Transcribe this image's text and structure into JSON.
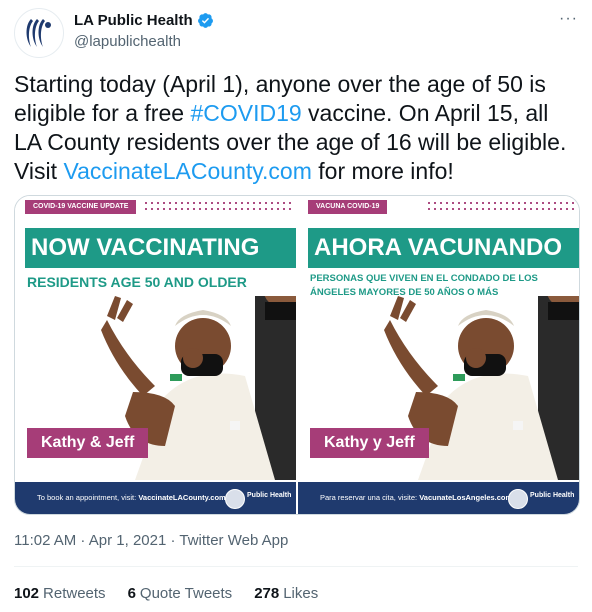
{
  "header": {
    "name": "LA Public Health",
    "handle": "@lapublichealth",
    "more_label": "···"
  },
  "tweet": {
    "text_1": "Starting today (April 1), anyone over the age of 50 is eligible for a free ",
    "hashtag": "#COVID19",
    "text_2": " vaccine. On April 15, all LA County residents over the age of 16 will be eligible. Visit ",
    "link": "VaccinateLACounty.com",
    "text_3": " for more info!"
  },
  "media": {
    "english": {
      "tag": "COVID-19 VACCINE UPDATE",
      "banner": "NOW VACCINATING",
      "subtitle": "RESIDENTS AGE 50 AND OLDER",
      "names": "Kathy & Jeff",
      "footer_text": "To book an appointment, visit: ",
      "footer_link": "VaccinateLACounty.com",
      "footer_org": "Public Health"
    },
    "spanish": {
      "tag": "VACUNA COVID-19",
      "banner": "AHORA VACUNANDO",
      "subtitle": "PERSONAS QUE VIVEN EN EL CONDADO DE LOS ÁNGELES MAYORES DE 50 AÑOS O MÁS",
      "names": "Kathy y Jeff",
      "footer_text": "Para reservar una cita, visite: ",
      "footer_link": "VacunateLosAngeles.com",
      "footer_org": "Public Health"
    }
  },
  "meta": {
    "timestamp": "11:02 AM · Apr 1, 2021 · Twitter Web App"
  },
  "stats": {
    "retweets_count": "102",
    "retweets_label": "Retweets",
    "quotes_count": "6",
    "quotes_label": "Quote Tweets",
    "likes_count": "278",
    "likes_label": "Likes"
  },
  "colors": {
    "link": "#1d9bf0",
    "teal": "#1e9a87",
    "magenta": "#a63d78",
    "navy": "#1f3a6e"
  }
}
